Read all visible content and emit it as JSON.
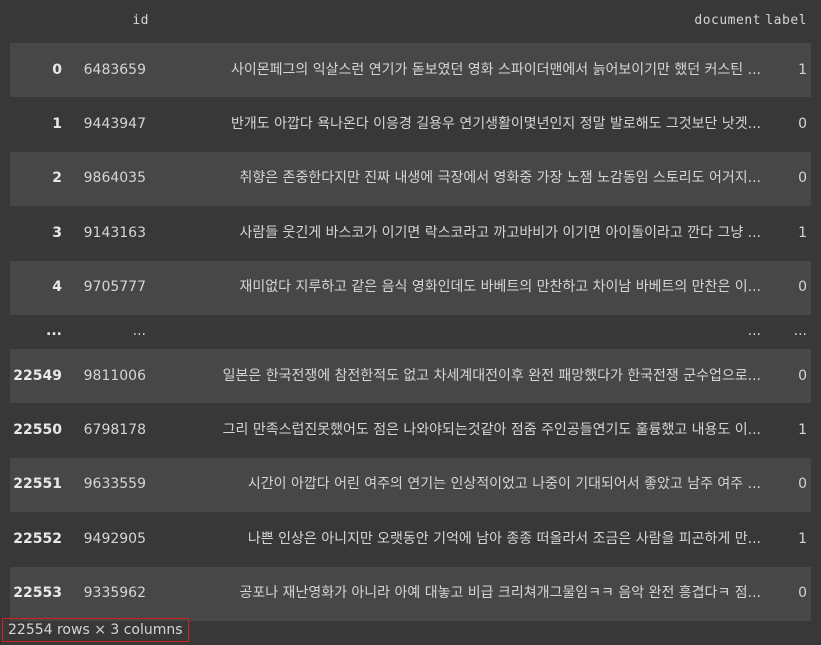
{
  "table": {
    "columns": {
      "index": "",
      "id": "id",
      "document": "document",
      "label": "label"
    },
    "rows": [
      {
        "index": "0",
        "id": "6483659",
        "document": "사이몬페그의 익살스런 연기가 돋보였던 영화 스파이더맨에서 늙어보이기만 했던 커스틴 ...",
        "label": "1"
      },
      {
        "index": "1",
        "id": "9443947",
        "document": "반개도 아깝다 욕나온다 이응경 길용우 연기생활이몇년인지 정말 발로해도 그것보단 낫겟...",
        "label": "0"
      },
      {
        "index": "2",
        "id": "9864035",
        "document": "취향은 존중한다지만 진짜 내생에 극장에서 영화중 가장 노잼 노감동임 스토리도 어거지...",
        "label": "0"
      },
      {
        "index": "3",
        "id": "9143163",
        "document": "사람들 웃긴게 바스코가 이기면 락스코라고 까고바비가 이기면 아이돌이라고 깐다 그냥 ...",
        "label": "1"
      },
      {
        "index": "4",
        "id": "9705777",
        "document": "재미없다 지루하고 같은 음식 영화인데도 바베트의 만찬하고 차이남 바베트의 만찬은 이...",
        "label": "0"
      },
      {
        "index": "...",
        "id": "...",
        "document": "...",
        "label": "..."
      },
      {
        "index": "22549",
        "id": "9811006",
        "document": "일본은 한국전쟁에 참전한적도 없고 차세계대전이후 완전 패망했다가 한국전쟁 군수업으로...",
        "label": "0"
      },
      {
        "index": "22550",
        "id": "6798178",
        "document": "그리 만족스럽진못했어도 점은 나와야되는것같아 점줌 주인공들연기도 훌륭했고 내용도 이...",
        "label": "1"
      },
      {
        "index": "22551",
        "id": "9633559",
        "document": "시간이 아깝다 어린 여주의 연기는 인상적이었고 나중이 기대되어서 좋았고 남주 여주 ...",
        "label": "0"
      },
      {
        "index": "22552",
        "id": "9492905",
        "document": "나쁜 인상은 아니지만 오랫동안 기억에 남아 종종 떠올라서 조금은 사람을 피곤하게 만...",
        "label": "1"
      },
      {
        "index": "22553",
        "id": "9335962",
        "document": "공포나 재난영화가 아니라 아예 대놓고 비급 크리쳐개그물임ㅋㅋ 음악 완전 흥겹다ㅋ 점...",
        "label": "0"
      }
    ]
  },
  "summary": "22554 rows × 3 columns",
  "colors": {
    "background": "#383838",
    "stripe": "#474747",
    "highlight_border": "#d02020"
  }
}
